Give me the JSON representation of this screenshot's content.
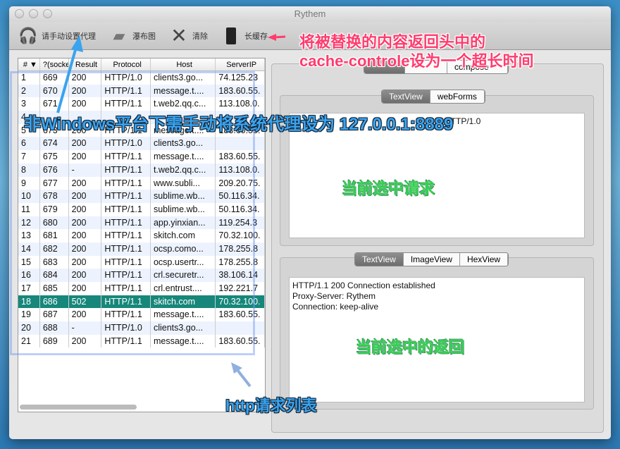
{
  "window": {
    "title": "Rythem"
  },
  "toolbar": {
    "items": [
      {
        "label": "请手动设置代理",
        "icon": "headphones-icon"
      },
      {
        "label": "瀑布图",
        "icon": "piano-icon"
      },
      {
        "label": "清除",
        "icon": "x-icon"
      },
      {
        "label": "长缓存",
        "icon": "speaker-icon"
      }
    ]
  },
  "table": {
    "columns": [
      "#",
      "?(socke",
      "Result",
      "Protocol",
      "Host",
      "ServerIP"
    ],
    "rows": [
      [
        "1",
        "669",
        "200",
        "HTTP/1.0",
        "clients3.go...",
        "74.125.23"
      ],
      [
        "2",
        "670",
        "200",
        "HTTP/1.1",
        "message.t....",
        "183.60.55."
      ],
      [
        "3",
        "671",
        "200",
        "HTTP/1.1",
        "t.web2.qq.c...",
        "113.108.0."
      ],
      [
        "4",
        "",
        "",
        "",
        "",
        ""
      ],
      [
        "5",
        "673",
        "200",
        "HTTP/1.1",
        "message.t....",
        "183.60.55."
      ],
      [
        "6",
        "674",
        "200",
        "HTTP/1.0",
        "clients3.go...",
        ""
      ],
      [
        "7",
        "675",
        "200",
        "HTTP/1.1",
        "message.t....",
        "183.60.55."
      ],
      [
        "8",
        "676",
        "-",
        "HTTP/1.1",
        "t.web2.qq.c...",
        "113.108.0."
      ],
      [
        "9",
        "677",
        "200",
        "HTTP/1.1",
        "www.subli...",
        "209.20.75."
      ],
      [
        "10",
        "678",
        "200",
        "HTTP/1.1",
        "sublime.wb...",
        "50.116.34."
      ],
      [
        "11",
        "679",
        "200",
        "HTTP/1.1",
        "sublime.wb...",
        "50.116.34."
      ],
      [
        "12",
        "680",
        "200",
        "HTTP/1.1",
        "app.yinxian...",
        "119.254.3"
      ],
      [
        "13",
        "681",
        "200",
        "HTTP/1.1",
        "skitch.com",
        "70.32.100."
      ],
      [
        "14",
        "682",
        "200",
        "HTTP/1.1",
        "ocsp.como...",
        "178.255.8"
      ],
      [
        "15",
        "683",
        "200",
        "HTTP/1.1",
        "ocsp.usertr...",
        "178.255.8"
      ],
      [
        "16",
        "684",
        "200",
        "HTTP/1.1",
        "crl.securetr...",
        "38.106.14"
      ],
      [
        "17",
        "685",
        "200",
        "HTTP/1.1",
        "crl.entrust....",
        "192.221.7"
      ],
      [
        "18",
        "686",
        "502",
        "HTTP/1.1",
        "skitch.com",
        "70.32.100."
      ],
      [
        "19",
        "687",
        "200",
        "HTTP/1.1",
        "message.t....",
        "183.60.55."
      ],
      [
        "20",
        "688",
        "-",
        "HTTP/1.0",
        "clients3.go...",
        ""
      ],
      [
        "21",
        "689",
        "200",
        "HTTP/1.1",
        "message.t....",
        "183.60.55."
      ]
    ],
    "selected_row": 18
  },
  "right": {
    "top_tabs": [
      "",
      "",
      "compose"
    ],
    "request_tabs": [
      "TextView",
      "webForms"
    ],
    "request_text": "HTTP/1.0",
    "response_tabs": [
      "TextView",
      "ImageView",
      "HexView"
    ],
    "response_lines": [
      "HTTP/1.1 200 Connection established",
      "Proxy-Server: Rythem",
      "Connection: keep-alive"
    ]
  },
  "annotations": {
    "proxy_note": "非Windows平台下需手动将系统代理设为 127.0.0.1:8889",
    "cache_note_1": "将被替换的内容返回头中的",
    "cache_note_2": "cache-controle设为一个超长时间",
    "request_note": "当前选中请求",
    "response_note": "当前选中的返回",
    "list_note": "http请求列表"
  },
  "colors": {
    "selected_row": "#16877a",
    "annotation_blue": "#3aa3ee",
    "annotation_green": "#2fd14a",
    "annotation_pink": "#ff3c6e"
  }
}
